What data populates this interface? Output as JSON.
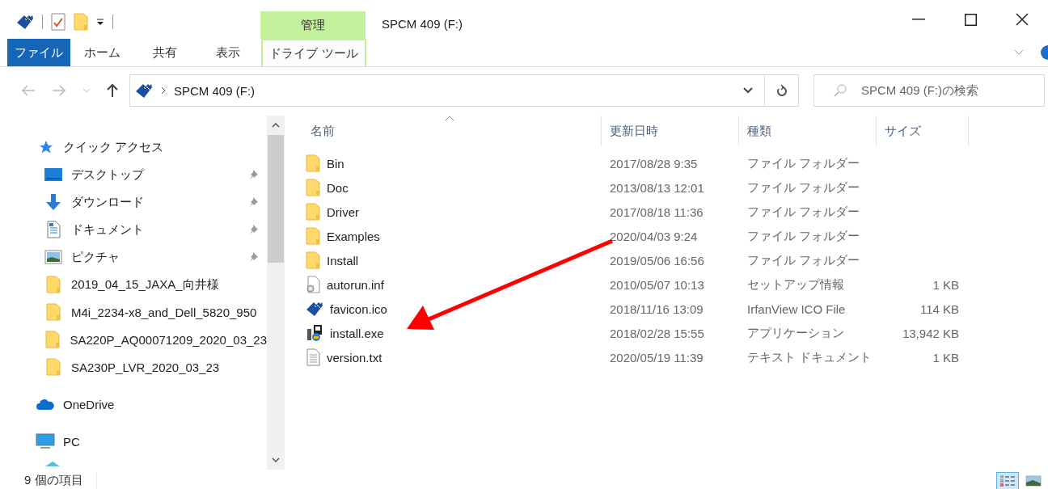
{
  "window": {
    "title": "SPCM 409 (F:)"
  },
  "ribbon": {
    "context_group": "管理",
    "tabs": [
      {
        "label": "ファイル",
        "kind": "file",
        "selected": false
      },
      {
        "label": "ホーム",
        "kind": "tab",
        "selected": false
      },
      {
        "label": "共有",
        "kind": "tab",
        "selected": false
      },
      {
        "label": "表示",
        "kind": "tab",
        "selected": false
      },
      {
        "label": "ドライブ ツール",
        "kind": "context",
        "selected": true
      }
    ]
  },
  "address": {
    "path": "SPCM 409 (F:)",
    "search_placeholder": "SPCM 409 (F:)の検索"
  },
  "nav": {
    "items": [
      {
        "label": "クイック アクセス",
        "kind": "star",
        "children": [
          {
            "label": "デスクトップ",
            "kind": "desktop",
            "pinned": true
          },
          {
            "label": "ダウンロード",
            "kind": "download",
            "pinned": true
          },
          {
            "label": "ドキュメント",
            "kind": "document",
            "pinned": true
          },
          {
            "label": "ピクチャ",
            "kind": "picture",
            "pinned": true
          },
          {
            "label": "2019_04_15_JAXA_向井様",
            "kind": "folder",
            "pinned": false
          },
          {
            "label": "M4i_2234-x8_and_Dell_5820_950",
            "kind": "folder",
            "pinned": false
          },
          {
            "label": "SA220P_AQ00071209_2020_03_23",
            "kind": "folder",
            "pinned": false
          },
          {
            "label": "SA230P_LVR_2020_03_23",
            "kind": "folder",
            "pinned": false
          }
        ]
      },
      {
        "label": "OneDrive",
        "kind": "cloud"
      },
      {
        "label": "PC",
        "kind": "pc"
      }
    ]
  },
  "table": {
    "columns": [
      {
        "label": "名前",
        "sorted": true
      },
      {
        "label": "更新日時",
        "sorted": false
      },
      {
        "label": "種類",
        "sorted": false
      },
      {
        "label": "サイズ",
        "sorted": false
      }
    ],
    "rows": [
      {
        "name": "Bin",
        "date": "2017/08/28 9:35",
        "type": "ファイル フォルダー",
        "kind": "folder"
      },
      {
        "name": "Doc",
        "date": "2013/08/13 12:01",
        "type": "ファイル フォルダー",
        "kind": "folder"
      },
      {
        "name": "Driver",
        "date": "2017/08/18 11:36",
        "type": "ファイル フォルダー",
        "kind": "folder"
      },
      {
        "name": "Examples",
        "date": "2020/04/03 9:24",
        "type": "ファイル フォルダー",
        "kind": "folder"
      },
      {
        "name": "Install",
        "date": "2019/05/06 16:56",
        "type": "ファイル フォルダー",
        "kind": "folder"
      },
      {
        "name": "autorun.inf",
        "date": "2010/05/07 10:13",
        "type": "セットアップ情報",
        "size": "1 KB",
        "kind": "settings"
      },
      {
        "name": "favicon.ico",
        "date": "2018/11/16 13:09",
        "type": "IrfanView ICO File",
        "size": "114 KB",
        "kind": "logo"
      },
      {
        "name": "install.exe",
        "date": "2018/02/28 15:55",
        "type": "アプリケーション",
        "size": "13,942 KB",
        "kind": "installer"
      },
      {
        "name": "version.txt",
        "date": "2020/05/19 11:39",
        "type": "テキスト ドキュメント",
        "size": "1 KB",
        "kind": "text"
      }
    ]
  },
  "status_bar": {
    "item_count": "9 個の項目",
    "views": [
      {
        "kind": "details",
        "selected": true
      },
      {
        "kind": "thumbnails",
        "selected": false
      }
    ]
  }
}
